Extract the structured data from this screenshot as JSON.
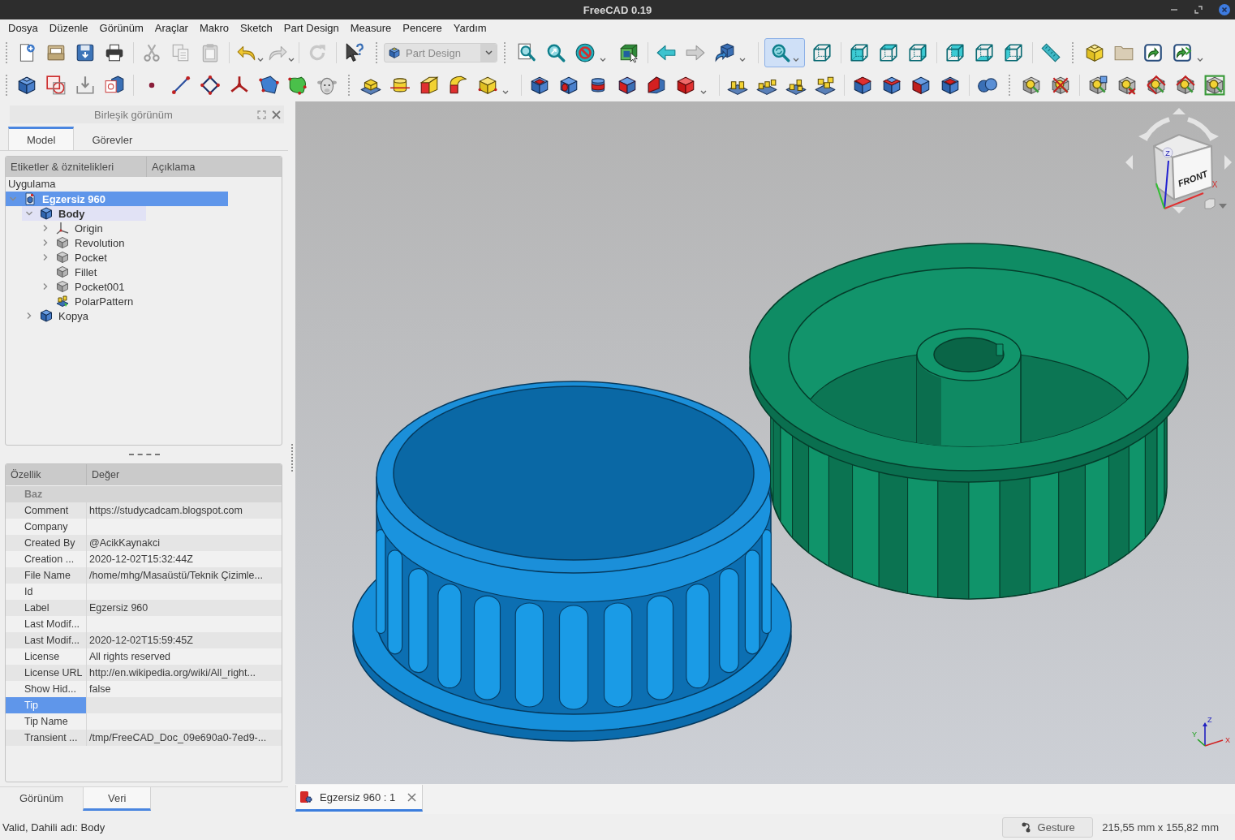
{
  "window": {
    "title": "FreeCAD 0.19"
  },
  "menu": [
    "Dosya",
    "Düzenle",
    "Görünüm",
    "Araçlar",
    "Makro",
    "Sketch",
    "Part Design",
    "Measure",
    "Pencere",
    "Yardım"
  ],
  "toolbar": {
    "workbench": "Part Design",
    "zoom_pressed": true
  },
  "combo_view": {
    "title": "Birleşik görünüm",
    "tabs": [
      {
        "label": "Model",
        "selected": true
      },
      {
        "label": "Görevler",
        "selected": false
      }
    ],
    "tree": {
      "columns": [
        "Etiketler & öznitelikleri",
        "Açıklama"
      ],
      "root": "Uygulama",
      "items": [
        {
          "label": "Egzersiz 960",
          "kind": "document",
          "expanded": true,
          "selected": true,
          "active": true,
          "children": [
            {
              "label": "Body",
              "kind": "body",
              "expanded": true,
              "selected": false,
              "active": true,
              "children": [
                {
                  "label": "Origin",
                  "kind": "origin",
                  "expanded": false,
                  "selected": false,
                  "active": false
                },
                {
                  "label": "Revolution",
                  "kind": "feature",
                  "expanded": false,
                  "selected": false,
                  "active": false
                },
                {
                  "label": "Pocket",
                  "kind": "feature",
                  "expanded": false,
                  "selected": false,
                  "active": false
                },
                {
                  "label": "Fillet",
                  "kind": "feature",
                  "selected": false,
                  "active": false
                },
                {
                  "label": "Pocket001",
                  "kind": "feature",
                  "expanded": false,
                  "selected": false,
                  "active": false
                },
                {
                  "label": "PolarPattern",
                  "kind": "pattern",
                  "selected": false,
                  "active": false
                }
              ]
            },
            {
              "label": "Kopya",
              "kind": "body",
              "expanded": false,
              "selected": false,
              "active": false
            }
          ]
        }
      ]
    },
    "properties": {
      "columns": [
        "Özellik",
        "Değer"
      ],
      "group": "Baz",
      "rows": [
        {
          "name": "Comment",
          "value": "https://studycadcam.blogspot.com",
          "selected": false
        },
        {
          "name": "Company",
          "selected": false
        },
        {
          "name": "Created By",
          "value": "@AcikKaynakci",
          "selected": false
        },
        {
          "name": "Creation ...",
          "value": "2020-12-02T15:32:44Z",
          "selected": false
        },
        {
          "name": "File Name",
          "value": "/home/mhg/Masaüstü/Teknik Çizimle...",
          "selected": false
        },
        {
          "name": "Id",
          "selected": false
        },
        {
          "name": "Label",
          "value": "Egzersiz 960",
          "selected": false
        },
        {
          "name": "Last Modif...",
          "selected": false
        },
        {
          "name": "Last Modif...",
          "value": "2020-12-02T15:59:45Z",
          "selected": false
        },
        {
          "name": "License",
          "value": "All rights reserved",
          "selected": false
        },
        {
          "name": "License URL",
          "value": "http://en.wikipedia.org/wiki/All_right...",
          "selected": false
        },
        {
          "name": "Show Hid...",
          "value": "false",
          "selected": false
        },
        {
          "name": "Tip",
          "selected": true
        },
        {
          "name": "Tip Name",
          "selected": false
        },
        {
          "name": "Transient ...",
          "value": "/tmp/FreeCAD_Doc_09e690a0-7ed9-...",
          "selected": false
        }
      ]
    },
    "bottom_tabs": [
      {
        "label": "Görünüm",
        "selected": false
      },
      {
        "label": "Veri",
        "selected": true
      }
    ]
  },
  "viewport": {
    "nav_cube": {
      "face_label": "FRONT",
      "axis_labels": [
        "Z",
        "X"
      ]
    },
    "axis_labels": [
      "Z",
      "Y",
      "X"
    ]
  },
  "document_tabs": [
    {
      "label": "Egzersiz 960 : 1",
      "selected": true
    }
  ],
  "status_bar": {
    "message": "Valid, Dahili adı: Body",
    "navigation_style": "Gesture",
    "dimensions": "215,55 mm x 155,82 mm"
  }
}
